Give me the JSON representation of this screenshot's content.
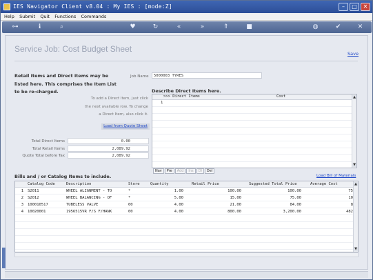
{
  "window": {
    "title": "IES Navigator Client v8.04 : My IES :       [mode:Z]"
  },
  "menu": [
    "Help",
    "Submit",
    "Quit",
    "Functions",
    "Commands"
  ],
  "toolbar_icons": [
    "key-icon",
    "info-icon",
    "search-icon",
    "heart-icon",
    "refresh-icon",
    "rewind-icon",
    "fast-forward-icon",
    "upload-icon",
    "stop-icon",
    "globe-icon",
    "check-icon",
    "close-icon"
  ],
  "page": {
    "title": "Service Job: Cost Budget Sheet",
    "save": "Save"
  },
  "intro": {
    "line1": "Retail Items and Direct Items may be",
    "line2": "listed here. This comprises the Item List",
    "line3": "to be re-charged."
  },
  "job": {
    "label": "Job Name",
    "value": "5000003 TYRES"
  },
  "describe_label": "Describe Direct Items here.",
  "hint": {
    "line1": "To add a Direct Item, just click",
    "line2": "the next available row. To change",
    "line3": "a Direct Item, also click it."
  },
  "load_quote": "Load from Quote Sheet",
  "totals": [
    {
      "label": "Total Direct Items",
      "value": "0.00"
    },
    {
      "label": "Total Retail Items",
      "value": "2,089.92"
    },
    {
      "label": "Quote Total before Tax",
      "value": "2,089.92"
    }
  ],
  "direct_items": {
    "col1": ">>>  Direct Items",
    "col2": "Cost",
    "row_marker": "1"
  },
  "nav_buttons": [
    "Nav",
    "Pre",
    "Add",
    "Ins",
    "Dl",
    "Del"
  ],
  "bills": {
    "label": "Bills and / or Catalog Items to include.",
    "load_bom": "Load Bill of Materials"
  },
  "bom_headers": {
    "code": "Catalog Code",
    "desc": "Description",
    "store": "Store",
    "qty": "Quantity",
    "price": "Retail Price",
    "total": "Suggested Total Price",
    "avg": "Average Cost"
  },
  "bom_rows": [
    {
      "n": "1",
      "code": "S2011",
      "desc": "WHEEL ALIGNMENT - TO",
      "store": "*",
      "qty": "1.00",
      "price": "100.00",
      "total": "100.00",
      "avg": "75"
    },
    {
      "n": "2",
      "code": "S2012",
      "desc": "WHEEL BALANCING - OF",
      "store": "*",
      "qty": "5.00",
      "price": "15.00",
      "total": "75.00",
      "avg": "10"
    },
    {
      "n": "3",
      "code": "100010517",
      "desc": "TUBELESS VALVE",
      "store": "00",
      "qty": "4.00",
      "price": "21.00",
      "total": "84.00",
      "avg": "8"
    },
    {
      "n": "4",
      "code": "10020001",
      "desc": "1956515VR F/S F/HANK",
      "store": "00",
      "qty": "4.00",
      "price": "800.00",
      "total": "3,200.00",
      "avg": "482"
    }
  ]
}
